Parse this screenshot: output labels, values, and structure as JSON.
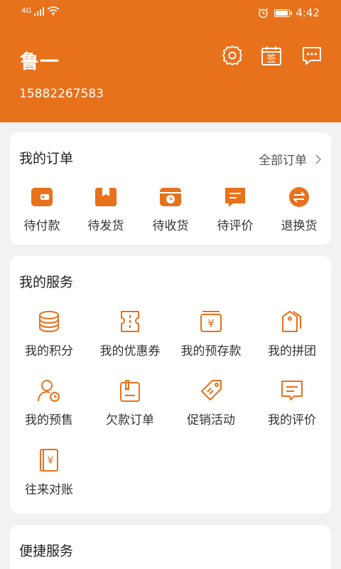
{
  "status_bar": {
    "network": "4G",
    "signal_bars": 4,
    "time": "4:42",
    "battery_fraction": 0.85
  },
  "colors": {
    "brand": "#e8711b",
    "background": "#f2f2f2",
    "card": "#ffffff"
  },
  "user": {
    "name": "鲁一",
    "phone": "15882267583"
  },
  "header_actions": [
    {
      "icon": "settings-icon"
    },
    {
      "icon": "sign-in-icon",
      "text": "签"
    },
    {
      "icon": "message-icon"
    }
  ],
  "orders": {
    "title": "我的订单",
    "all_label": "全部订单",
    "items": [
      {
        "label": "待付款",
        "icon": "wallet-icon"
      },
      {
        "label": "待发货",
        "icon": "box-icon"
      },
      {
        "label": "待收货",
        "icon": "truck-icon"
      },
      {
        "label": "待评价",
        "icon": "comment-icon"
      },
      {
        "label": "退换货",
        "icon": "exchange-icon"
      }
    ]
  },
  "services": {
    "title": "我的服务",
    "items": [
      {
        "label": "我的积分",
        "icon": "points-icon"
      },
      {
        "label": "我的优惠券",
        "icon": "coupon-icon"
      },
      {
        "label": "我的预存款",
        "icon": "deposit-icon"
      },
      {
        "label": "我的拼团",
        "icon": "group-buy-icon"
      },
      {
        "label": "我的预售",
        "icon": "presale-icon"
      },
      {
        "label": "欠款订单",
        "icon": "debt-order-icon"
      },
      {
        "label": "促销活动",
        "icon": "promotion-icon"
      },
      {
        "label": "我的评价",
        "icon": "review-icon"
      },
      {
        "label": "往来对账",
        "icon": "reconciliation-icon",
        "glyph": "¥"
      }
    ]
  },
  "quick_services": {
    "title": "便捷服务"
  }
}
